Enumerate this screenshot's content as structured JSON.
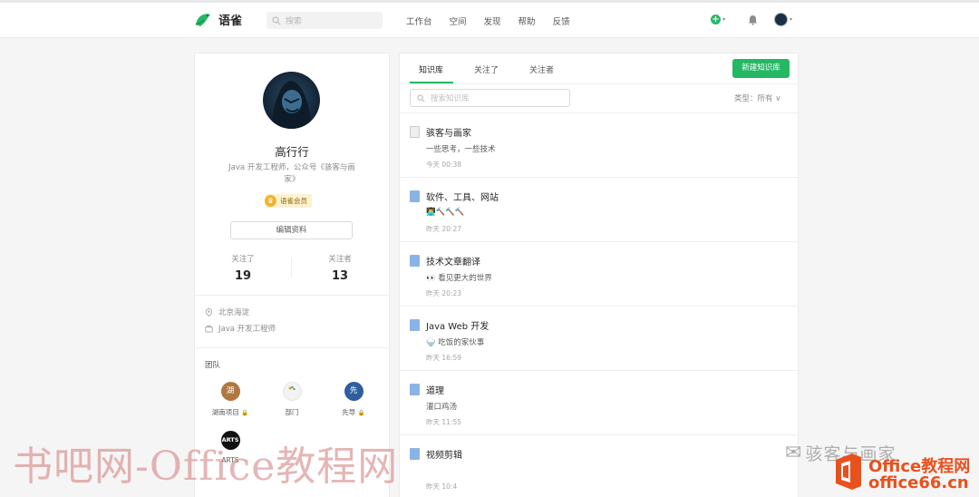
{
  "header": {
    "logo_text": "语雀",
    "search_placeholder": "搜索",
    "nav": [
      "工作台",
      "空间",
      "发现",
      "帮助",
      "反馈"
    ],
    "caret": "▾"
  },
  "profile": {
    "name": "高行行",
    "bio": "Java 开发工程师，公众号《骇客与画家》",
    "badge": "语雀会员",
    "edit_button": "编辑资料",
    "following_label": "关注了",
    "following_count": "19",
    "followers_label": "关注者",
    "followers_count": "13",
    "location": "北京海淀",
    "job": "Java 开发工程师",
    "teams_title": "团队",
    "teams": [
      {
        "name": "湖南项目",
        "icon_text": "湖",
        "locked": true,
        "color": "#b07840"
      },
      {
        "name": "部门",
        "icon_text": "",
        "locked": false,
        "color": "#f3f3f3"
      },
      {
        "name": "先导",
        "icon_text": "先",
        "locked": true,
        "color": "#2e5e9e"
      },
      {
        "name": "ARTS",
        "icon_text": "ARTS",
        "locked": false,
        "color": "#111111"
      }
    ]
  },
  "main": {
    "tabs": [
      "知识库",
      "关注了",
      "关注者"
    ],
    "new_button": "新建知识库",
    "search_placeholder": "搜索知识库",
    "type_filter": "类型：所有 ∨",
    "books": [
      {
        "title": "骇客与画家",
        "desc": "一些思考，一些技术",
        "time": "今天 00:38",
        "icon": "doc"
      },
      {
        "title": "软件、工具、网站",
        "desc": "👨‍💻🔨🔨🔨",
        "time": "昨天 20:27",
        "icon": "blue"
      },
      {
        "title": "技术文章翻译",
        "desc": "👀 看见更大的世界",
        "time": "昨天 20:23",
        "icon": "blue"
      },
      {
        "title": "Java Web 开发",
        "desc": "🍚 吃饭的家伙事",
        "time": "昨天 16:59",
        "icon": "blue"
      },
      {
        "title": "道理",
        "desc": "灌口鸡汤",
        "time": "昨天 11:55",
        "icon": "blue"
      },
      {
        "title": "视频剪辑",
        "desc": "",
        "time": "昨天 10:4",
        "icon": "blue"
      }
    ]
  },
  "watermarks": {
    "left": "书吧网-Office教程网",
    "right_name": "骇客与画家",
    "office_line1": "Office教程网",
    "office_line2": "office66.cn"
  },
  "colors": {
    "accent": "#25b864",
    "book_icon": "#8ab4e6"
  }
}
